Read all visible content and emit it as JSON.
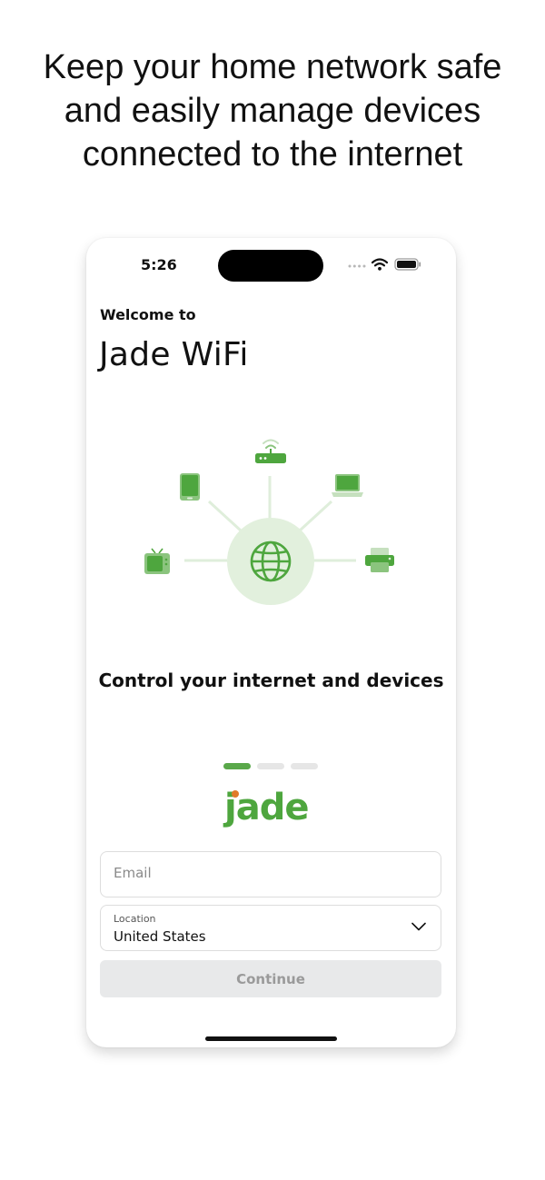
{
  "promo": {
    "headline_lines": [
      "Keep your home network safe",
      "and easily manage devices",
      "connected to the internet"
    ]
  },
  "status_bar": {
    "time": "5:26",
    "icons": [
      "signal-dots-icon",
      "wifi-icon",
      "battery-icon"
    ]
  },
  "welcome": {
    "label": "Welcome to",
    "title": "Jade WiFi"
  },
  "illustration": {
    "icons": [
      "globe-icon",
      "router-icon",
      "tablet-icon",
      "laptop-icon",
      "tv-icon",
      "printer-icon"
    ]
  },
  "carousel": {
    "caption": "Control your internet and devices",
    "total_pages": 3,
    "active_page": 1
  },
  "logo": {
    "text": "jade"
  },
  "form": {
    "email_placeholder": "Email",
    "location_label": "Location",
    "location_value": "United States",
    "continue_label": "Continue"
  },
  "colors": {
    "brand_green": "#5aa84a",
    "light_green": "#e2f0dd",
    "logo_dot_orange": "#e07a2a",
    "disabled_button_bg": "#e8e9ea",
    "disabled_button_text": "#9a9a9a"
  }
}
